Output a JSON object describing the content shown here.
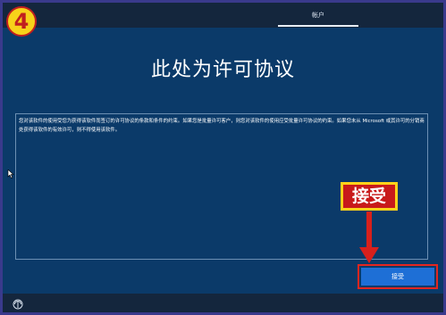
{
  "badge": {
    "number": "4"
  },
  "header": {
    "tab_account": "帐户"
  },
  "title": "此处为许可协议",
  "license": {
    "text": "您对该软件的使用受您为获得该软件而签订的许可协议的条款和条件的约束。如果您是批量许可客户，则您对该软件的使用应受批量许可协议的约束。如果您未从 Microsoft 或其许可的分销商处获得该软件的有效许可，则不得使用该软件。"
  },
  "callout": {
    "label": "接受"
  },
  "buttons": {
    "accept_label": "接受"
  },
  "colors": {
    "background": "#0b3a69",
    "bar": "#14263d",
    "accent_button": "#1e6fd6",
    "annotation_red": "#c81a1a",
    "annotation_yellow": "#ffd21a"
  },
  "icons": {
    "badge": "circled-number-icon",
    "cursor": "mouse-pointer-icon",
    "arrow": "down-arrow-icon",
    "accessibility": "ease-of-access-icon"
  }
}
